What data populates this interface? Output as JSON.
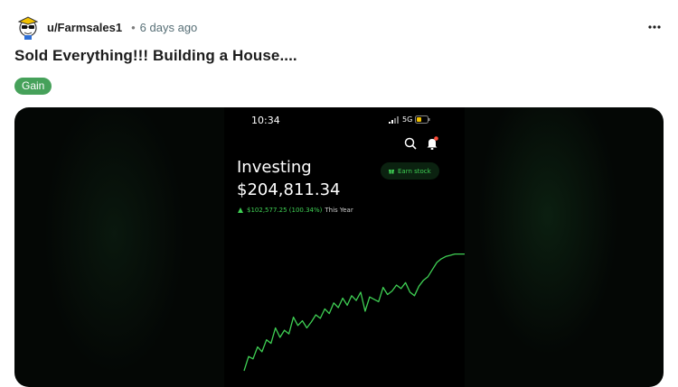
{
  "post": {
    "author": "u/Farmsales1",
    "separator": "•",
    "time_ago": "6 days ago",
    "title": "Sold Everything!!! Building a House....",
    "flair": "Gain",
    "colors": {
      "flair_bg": "#46a15a",
      "accent_green": "#3fd054"
    }
  },
  "screenshot": {
    "status_time": "10:34",
    "network": "5G",
    "portfolio_label": "Investing",
    "portfolio_value": "$204,811.34",
    "change_amount": "$102,577.25 (100.34%)",
    "change_period": "This Year",
    "earn_button_label": "Earn stock"
  },
  "chart_data": {
    "type": "line",
    "title": "",
    "xlabel": "",
    "ylabel": "",
    "grid": false,
    "note_values": "relative portfolio level read from the unlabeled line, roughly 0 (start) to 100 (current)",
    "x": [
      0,
      2,
      4,
      6,
      8,
      10,
      12,
      14,
      16,
      18,
      20,
      22,
      24,
      26,
      28,
      30,
      32,
      34,
      36,
      38,
      40,
      42,
      44,
      46,
      48,
      50,
      52,
      54,
      56,
      58,
      60,
      62,
      64,
      66,
      68,
      70,
      72,
      74,
      76,
      78,
      80,
      82,
      84,
      86,
      88,
      90,
      92,
      94,
      96,
      98,
      100
    ],
    "values": [
      0,
      12,
      10,
      20,
      16,
      26,
      23,
      36,
      28,
      34,
      31,
      45,
      38,
      42,
      36,
      41,
      47,
      44,
      52,
      48,
      57,
      53,
      61,
      55,
      63,
      59,
      66,
      50,
      62,
      60,
      58,
      70,
      64,
      67,
      72,
      69,
      74,
      66,
      63,
      71,
      76,
      79,
      85,
      91,
      94,
      96,
      97,
      98,
      98,
      98,
      98
    ],
    "ylim": [
      0,
      100
    ]
  }
}
